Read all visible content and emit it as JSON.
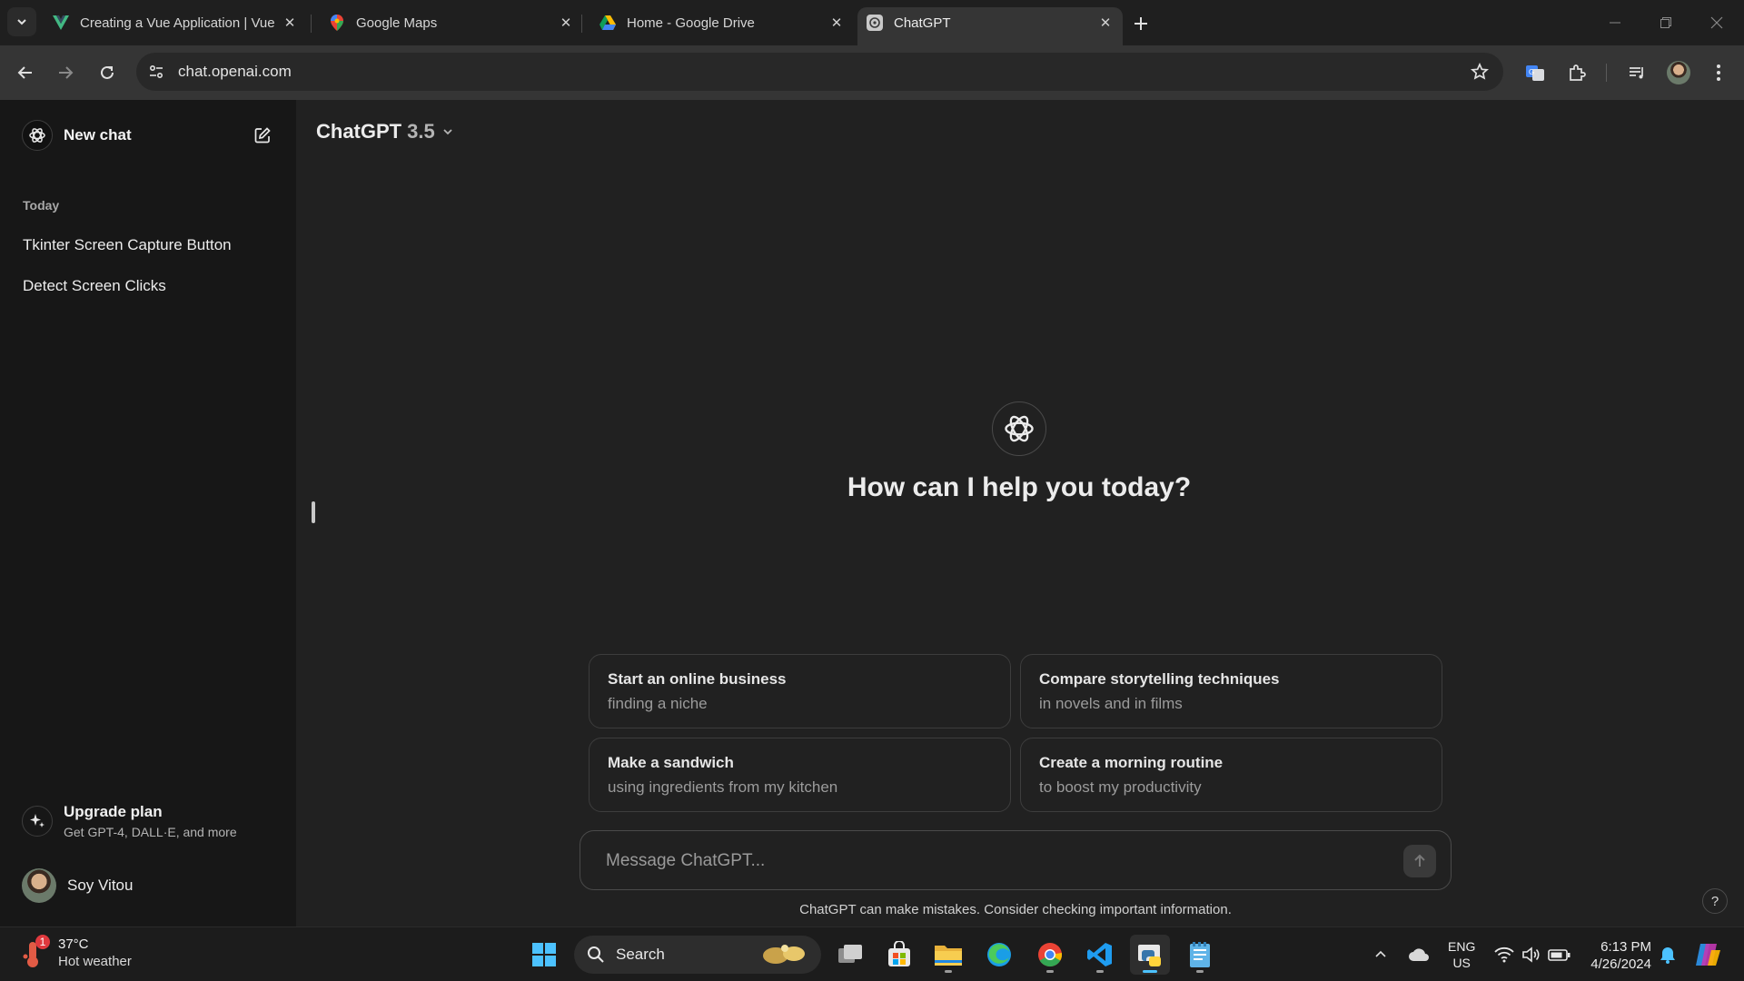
{
  "browser": {
    "tabs": [
      {
        "title": "Creating a Vue Application | Vue",
        "favicon": "vue-logo",
        "active": false
      },
      {
        "title": "Google Maps",
        "favicon": "maps-pin",
        "active": false
      },
      {
        "title": "Home - Google Drive",
        "favicon": "drive-logo",
        "active": false
      },
      {
        "title": "ChatGPT",
        "favicon": "chatgpt-logo",
        "active": true
      }
    ],
    "url": "chat.openai.com"
  },
  "sidebar": {
    "new_chat_label": "New chat",
    "section_today": "Today",
    "history": [
      {
        "label": "Tkinter Screen Capture Button"
      },
      {
        "label": "Detect Screen Clicks"
      }
    ],
    "upgrade_title": "Upgrade plan",
    "upgrade_subtitle": "Get GPT-4, DALL·E, and more",
    "user_name": "Soy Vitou"
  },
  "main": {
    "model_name": "ChatGPT",
    "model_version": "3.5",
    "greeting": "How can I help you today?",
    "suggestions": [
      {
        "title": "Start an online business",
        "subtitle": "finding a niche"
      },
      {
        "title": "Compare storytelling techniques",
        "subtitle": "in novels and in films"
      },
      {
        "title": "Make a sandwich",
        "subtitle": "using ingredients from my kitchen"
      },
      {
        "title": "Create a morning routine",
        "subtitle": "to boost my productivity"
      }
    ],
    "composer_placeholder": "Message ChatGPT...",
    "disclaimer": "ChatGPT can make mistakes. Consider checking important information.",
    "help_label": "?"
  },
  "taskbar": {
    "weather_temp": "37°C",
    "weather_condition": "Hot weather",
    "weather_alert": "1",
    "search_label": "Search",
    "lang_primary": "ENG",
    "lang_secondary": "US",
    "time": "6:13 PM",
    "date": "4/26/2024",
    "pinned_apps": [
      "windows-start",
      "task-view",
      "microsoft-store",
      "file-explorer",
      "edge",
      "chrome",
      "vscode",
      "python-idle",
      "notepad"
    ]
  },
  "colors": {
    "background": "#212121",
    "sidebar": "#171717",
    "accent_taskbar": "#4cc2ff"
  }
}
